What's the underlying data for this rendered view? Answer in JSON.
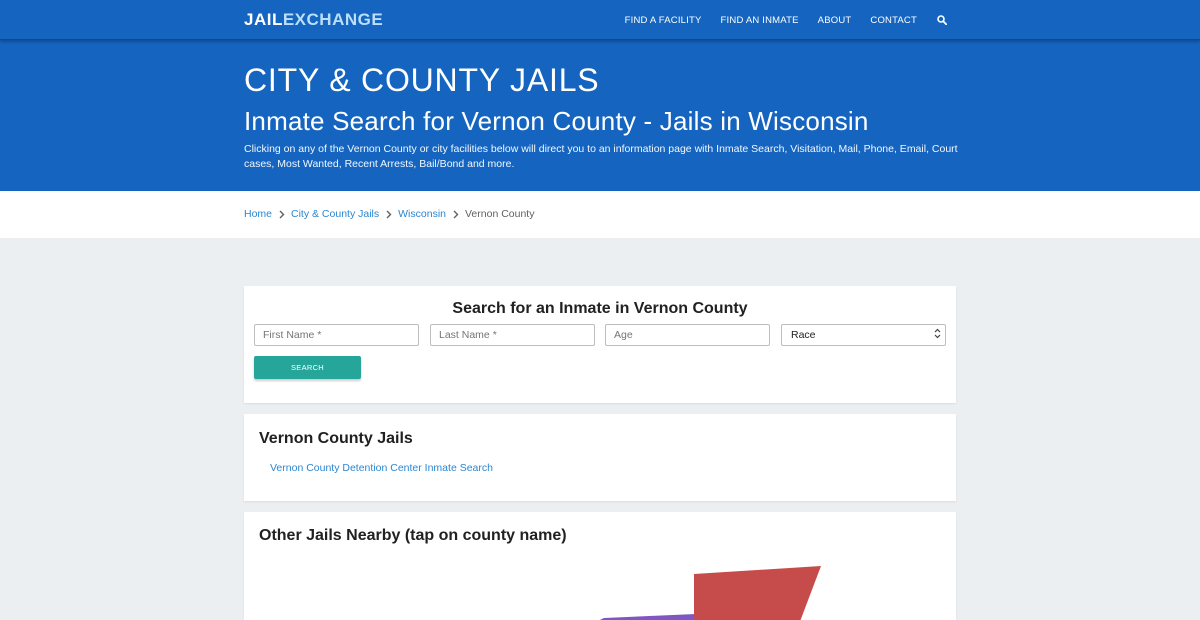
{
  "header": {
    "logo_part1": "JAIL",
    "logo_part2": "EXCHANGE",
    "nav": [
      "FIND A FACILITY",
      "FIND AN INMATE",
      "ABOUT",
      "CONTACT"
    ],
    "search_icon": "search-icon"
  },
  "hero": {
    "eyebrow": "CITY & COUNTY JAILS",
    "title": "Inmate Search for Vernon County - Jails in Wisconsin",
    "description": "Clicking on any of the Vernon County or city facilities below will direct you to an information page with Inmate Search, Visitation, Mail, Phone, Email, Court cases, Most Wanted, Recent Arrests, Bail/Bond and more."
  },
  "breadcrumb": {
    "home": "Home",
    "level1": "City & County Jails",
    "level2": "Wisconsin",
    "current": "Vernon County",
    "separator_icon": "chevron-right-icon"
  },
  "search_form": {
    "title": "Search for an Inmate in Vernon County",
    "first_name_placeholder": "First Name *",
    "first_name_value": "",
    "last_name_placeholder": "Last Name *",
    "last_name_value": "",
    "age_placeholder": "Age",
    "age_value": "",
    "race_selected": "Race",
    "button_label": "SEARCH"
  },
  "jails": {
    "heading": "Vernon County Jails",
    "items": [
      "Vernon County Detention Center Inmate Search"
    ]
  },
  "nearby": {
    "heading": "Other Jails Nearby (tap on county name)"
  },
  "colors": {
    "primary": "#1565c0",
    "accent_button": "#26a69a",
    "link": "#2b87d1",
    "map_red": "#c64b4b",
    "map_purple": "#7e57c2"
  }
}
